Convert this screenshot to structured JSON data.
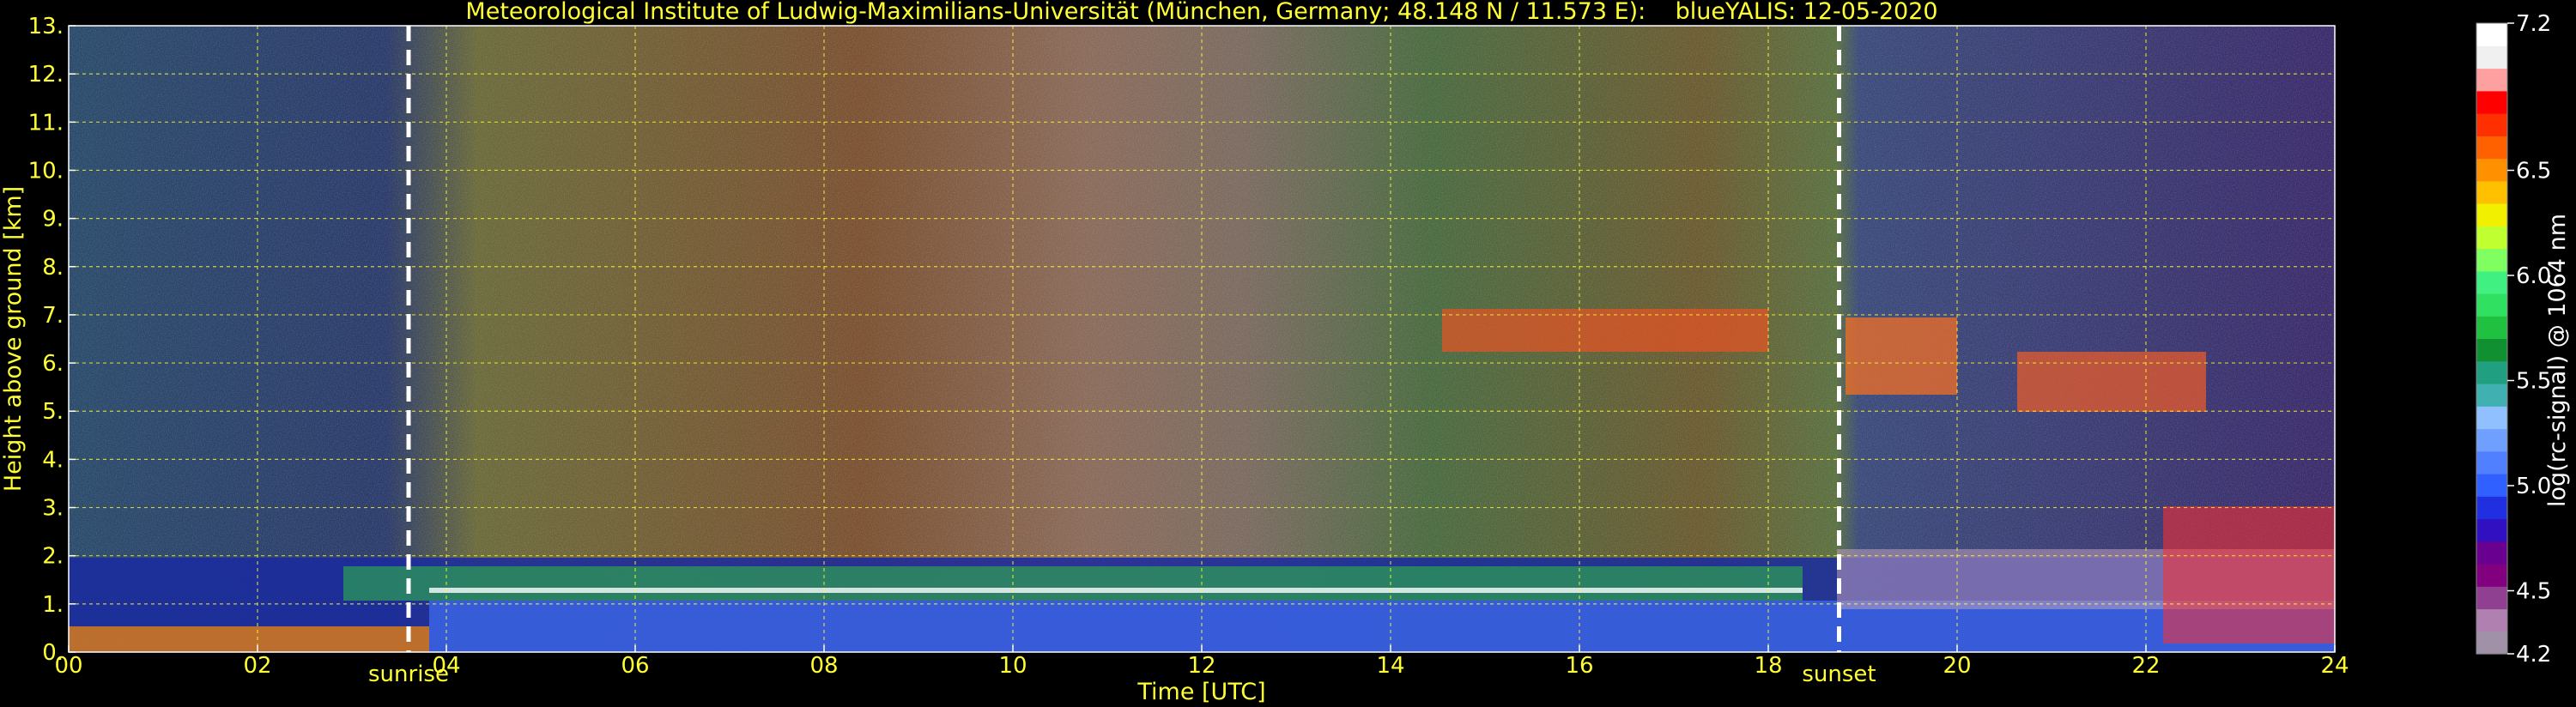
{
  "chart_data": {
    "type": "heatmap",
    "title": "Meteorological Institute of Ludwig-Maximilians-Universität (München, Germany; 48.148 N / 11.573 E):    blueYALIS: 12-05-2020",
    "xlabel": "Time [UTC]",
    "ylabel": "Height above ground [km]",
    "xlim": [
      0,
      24
    ],
    "ylim": [
      0,
      13
    ],
    "x_ticks": [
      "00",
      "02",
      "04",
      "06",
      "08",
      "10",
      "12",
      "14",
      "16",
      "18",
      "20",
      "22",
      "24"
    ],
    "y_ticks": [
      "0.",
      "1.",
      "2.",
      "3.",
      "4.",
      "5.",
      "6.",
      "7.",
      "8.",
      "9.",
      "10.",
      "11.",
      "12.",
      "13."
    ],
    "grid": true,
    "annotations": [
      {
        "label": "sunrise",
        "x": 3.6
      },
      {
        "label": "sunset",
        "x": 18.75
      }
    ],
    "colorbar": {
      "label": "log(rc-signal) @ 1064 nm",
      "range": [
        4.2,
        7.2
      ],
      "ticks": [
        "4.2",
        "4.5",
        "5.0",
        "5.5",
        "6.0",
        "6.5",
        "7.2"
      ],
      "colors": [
        "#a090a8",
        "#b080b0",
        "#904090",
        "#800080",
        "#6a0090",
        "#3010c0",
        "#2030e0",
        "#3060ff",
        "#5080ff",
        "#70a0ff",
        "#90c0ff",
        "#40b0b0",
        "#20a080",
        "#109030",
        "#20c040",
        "#30e060",
        "#40f080",
        "#80ff60",
        "#c0ff30",
        "#f0f000",
        "#ffc000",
        "#ff9000",
        "#ff6000",
        "#ff3000",
        "#ff0000",
        "#ffa0a0",
        "#f0f0f0",
        "#ffffff"
      ]
    }
  }
}
